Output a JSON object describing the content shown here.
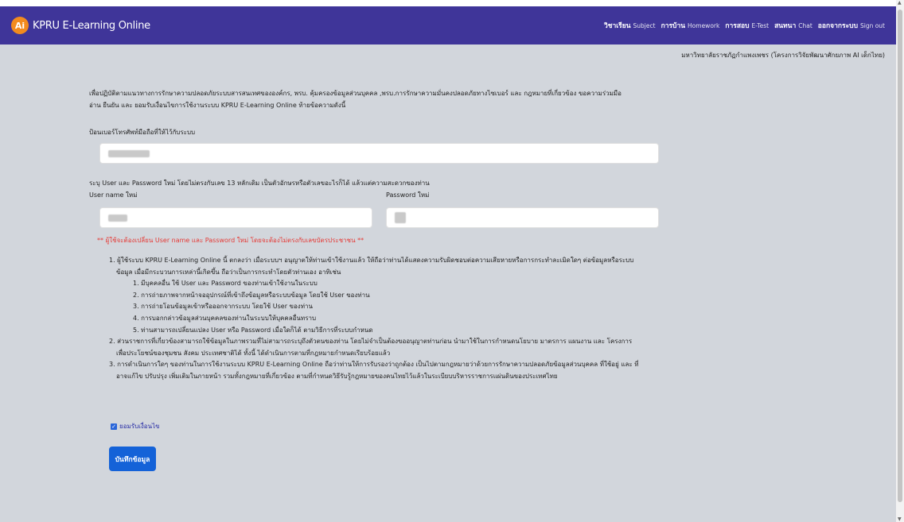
{
  "header": {
    "logo_text": "Ai",
    "title": "KPRU E-Learning Online",
    "nav": [
      {
        "th": "วิชาเรียน",
        "en": "Subject"
      },
      {
        "th": "การบ้าน",
        "en": "Homework"
      },
      {
        "th": "การสอบ",
        "en": "E-Test"
      },
      {
        "th": "สนทนา",
        "en": "Chat"
      },
      {
        "th": "ออกจากระบบ",
        "en": "Sign out"
      }
    ]
  },
  "university": "มหาวิทยาลัยราชภัฏกำแพงเพชร (โครงการวิจัยพัฒนาศักยภาพ AI เด็กไทย)",
  "intro": {
    "line1": "เพื่อปฏิบัติตามแนวทางการรักษาความปลอดภัยระบบสารสนเทศขององค์กร, พรบ. คุ้มครองข้อมูลส่วนบุคคล ,พรบ.การรักษาความมั่นคงปลอดภัยทางไซเบอร์ และ กฎหมายที่เกี่ยวข้อง ขอความร่วมมือ",
    "line2": "อ่าน ยืนยัน และ ยอมรับเงื่อนไขการใช้งานระบบ KPRU E-Learning Online ท้ายข้อความดังนี้"
  },
  "phone_label": "ป้อนเบอร์โทรศัพท์มือถือที่ให้ไว้กับระบบ",
  "credentials_note": "ระบุ User และ Password ใหม่ โดยไม่ตรงกับเลข 13 หลักเดิม เป็นตัวอักษรหรือตัวเลขอะไรก็ได้ แล้วแต่ความสะดวกของท่าน",
  "username_label": "User name ใหม่",
  "password_label": "Password ใหม่",
  "warning": "** ผู้ใช้จะต้องเปลี่ยน User name และ Password ใหม่ โดยจะต้องไม่ตรงกับเลขบัตรประชาชน **",
  "terms": {
    "t1a": "1. ผู้ใช้ระบบ KPRU E-Learning Online นี้ ตกลงว่า เมื่อระบบฯ อนุญาตให้ท่านเข้าใช้งานแล้ว ให้ถือว่าท่านได้แสดงความรับผิดชอบต่อความเสียหายหรือการกระทำละเมิดใดๆ ต่อข้อมูลหรือระบบ",
    "t1b": "ข้อมูล เมื่อมีกระบวนการเหล่านี้เกิดขึ้น ถือว่าเป็นการกระทำโดยตัวท่านเอง อาทิเช่น",
    "s1": "1. มีบุคคลอื่น ใช้ User และ Password ของท่านเข้าใช้งานในระบบ",
    "s2": "2. การถ่ายภาพจากหน้าจออุปกรณ์ที่เข้าถึงข้อมูลหรือระบบข้อมูล โดยใช้ User ของท่าน",
    "s3": "3. การถ่ายโอนข้อมูลเข้าหรือออกจากระบบ โดยใช้ User ของท่าน",
    "s4": "4. การบอกกล่าวข้อมูลส่วนบุคคลของท่านในระบบให้บุคคลอื่นทราบ",
    "s5": "5. ท่านสามารถเปลี่ยนแปลง User หรือ Password เมื่อใดก็ได้ ตามวิธีการที่ระบบกำหนด",
    "t2a": "2. ส่วนราชการที่เกี่ยวข้องสามารถใช้ข้อมูลในภาพรวมที่ไม่สามารถระบุถึงตัวตนของท่าน โดยไม่จำเป็นต้องขออนุญาตท่านก่อน นำมาใช้ในการกำหนดนโยบาย มาตรการ แผนงาน และ โครงการ",
    "t2b": "เพื่อประโยชน์ของชุมชน สังคม ประเทศชาติได้ ทั้งนี้ ได้ดำเนินการตามที่กฎหมายกำหนดเรียบร้อยแล้ว",
    "t3a": "3. การดำเนินการใดๆ ของท่านในการใช้งานระบบ KPRU E-Learning Online ถือว่าท่านให้การรับรองว่าถูกต้อง เป็นไปตามกฎหมายว่าด้วยการรักษาความปลอดภัยข้อมูลส่วนบุคคล ที่ใช้อยู่ และ ที่",
    "t3b": "อาจแก้ไข ปรับปรุง เพิ่มเติมในภายหน้า รวมทั้งกฎหมายที่เกี่ยวข้อง ตามที่กำหนดวิธีรับรู้กฎหมายของคนไทยไว้แล้วในระเบียบบริหารราชการแผ่นดินของประเทศไทย"
  },
  "agree_label": "ยอมรับเงื่อนไข",
  "save_label": "บันทึกข้อมูล"
}
